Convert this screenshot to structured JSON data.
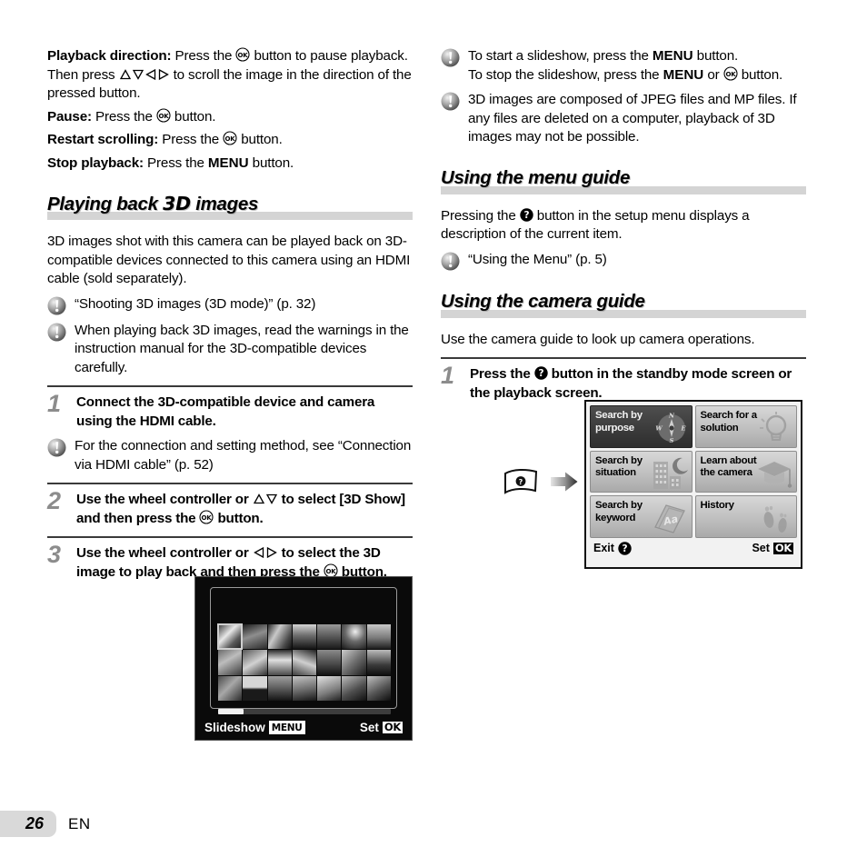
{
  "page": {
    "number": "26",
    "language": "EN"
  },
  "left_column": {
    "intro": {
      "playback_direction_label": "Playback direction:",
      "playback_direction_text_a": " Press the ",
      "playback_direction_text_b": " button to pause playback. Then press ",
      "playback_direction_text_c": " to scroll the image in the direction of the pressed button.",
      "pause_label": "Pause:",
      "pause_text_a": " Press the ",
      "pause_text_b": " button.",
      "restart_label": "Restart scrolling:",
      "restart_text_a": " Press the ",
      "restart_text_b": " button.",
      "stop_label": "Stop playback:",
      "stop_text_a": " Press the ",
      "stop_menu": "MENU",
      "stop_text_b": " button."
    },
    "heading": {
      "part1": "Playing back ",
      "part2": "3D",
      "part3": " images"
    },
    "body": "3D images shot with this camera can be played back on 3D-compatible devices connected to this camera using an HDMI cable (sold separately).",
    "notes": [
      "“Shooting 3D images (3D mode)” (p. 32)",
      "When playing back 3D images, read the warnings in the instruction manual for the 3D-compatible devices carefully."
    ],
    "steps": [
      {
        "number": "1",
        "text": "Connect the 3D-compatible device and camera using the HDMI cable.",
        "note": "For the connection and setting method, see “Connection via HDMI cable” (p. 52)"
      },
      {
        "number": "2",
        "text_a": "Use the wheel controller or ",
        "text_b": " to select [3D Show] and then press the ",
        "text_c": " button."
      },
      {
        "number": "3",
        "text_a": "Use the wheel controller or ",
        "text_b": " to select the 3D image to play back and then press the ",
        "text_c": " button."
      }
    ],
    "thumb_screen": {
      "left_label": "Slideshow",
      "left_tag": "MENU",
      "right_label": "Set",
      "right_tag": "OK",
      "columns": 7,
      "rows": 3,
      "selected_index": 0,
      "scroll_position": "start"
    }
  },
  "right_column": {
    "notes_top": [
      {
        "line1_a": "To start a slideshow, press the ",
        "line1_menu": "MENU",
        "line1_b": " button.",
        "line2_a": "To stop the slideshow, press the ",
        "line2_menu": "MENU",
        "line2_b": " or ",
        "line2_c": " button."
      },
      {
        "text": "3D images are composed of JPEG files and MP files. If any files are deleted on a computer, playback of 3D images may not be possible."
      }
    ],
    "menu_guide": {
      "heading": "Using the menu guide",
      "body_a": "Pressing the ",
      "body_b": " button in the setup menu displays a description of the current item.",
      "note": "“Using the Menu” (p. 5)"
    },
    "camera_guide": {
      "heading": "Using the camera guide",
      "body": "Use the camera guide to look up camera operations.",
      "step": {
        "number": "1",
        "text_a": "Press the ",
        "text_b": " button in the standby mode screen or the playback screen."
      },
      "screen": {
        "tiles": [
          {
            "label": "Search by purpose",
            "icon": "compass-icon",
            "selected": true
          },
          {
            "label": "Search for a solution",
            "icon": "lightbulb-icon",
            "selected": false
          },
          {
            "label": "Search by situation",
            "icon": "building-moon-icon",
            "selected": false
          },
          {
            "label": "Learn about the camera",
            "icon": "graduation-cap-icon",
            "selected": false
          },
          {
            "label": "Search by keyword",
            "icon": "book-aa-icon",
            "selected": false
          },
          {
            "label": "History",
            "icon": "footprints-icon",
            "selected": false
          }
        ],
        "exit_label": "Exit",
        "set_label": "Set",
        "set_tag": "OK",
        "compass_letters": {
          "n": "N",
          "e": "E",
          "s": "S",
          "w": "W"
        },
        "book_letters": "Aa"
      }
    }
  },
  "colors": {
    "heading_band": "#d4d4d4",
    "step_number": "#8c8c8c",
    "rule": "#3a3a3a",
    "screen_bg": "#0a0a0a",
    "tile_selected": "#3a3a3a",
    "page_tab": "#d9d9d9"
  }
}
